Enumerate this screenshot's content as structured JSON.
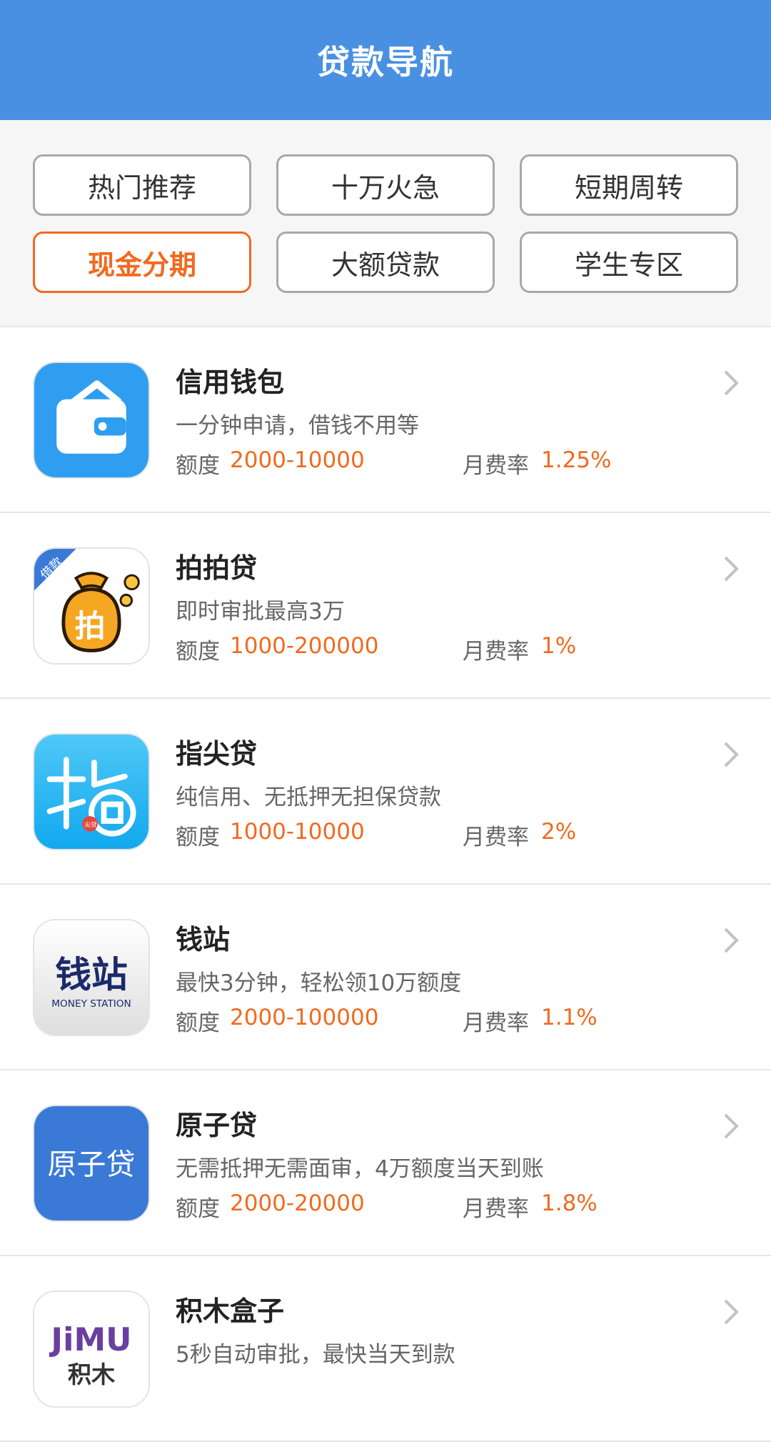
{
  "header": {
    "title": "贷款导航"
  },
  "filters": [
    {
      "label": "热门推荐",
      "active": false
    },
    {
      "label": "十万火急",
      "active": false
    },
    {
      "label": "短期周转",
      "active": false
    },
    {
      "label": "现金分期",
      "active": true
    },
    {
      "label": "大额贷款",
      "active": false
    },
    {
      "label": "学生专区",
      "active": false
    }
  ],
  "common": {
    "quota_label": "额度",
    "rate_label": "月费率"
  },
  "icons": {
    "ppd_badge": "借款",
    "ppd_char": "拍",
    "zjd_seal": "尖贷",
    "qz_name": "钱站",
    "qz_en": "MONEY STATION",
    "yzd_text": "原子贷",
    "jm_en": "JiMU",
    "jm_cn": "积木"
  },
  "loans": [
    {
      "name": "信用钱包",
      "desc": "一分钟申请，借钱不用等",
      "quota": "2000-10000",
      "rate": "1.25%",
      "icon": "wallet-app-icon",
      "color": "#2f9ef0"
    },
    {
      "name": "拍拍贷",
      "desc": "即时审批最高3万",
      "quota": "1000-200000",
      "rate": "1%",
      "icon": "money-bag-app-icon",
      "color": "#f5a623"
    },
    {
      "name": "指尖贷",
      "desc": "纯信用、无抵押无担保贷款",
      "quota": "1000-10000",
      "rate": "2%",
      "icon": "fingertip-app-icon",
      "color": "#1fb8f5"
    },
    {
      "name": "钱站",
      "desc": "最快3分钟，轻松领10万额度",
      "quota": "2000-100000",
      "rate": "1.1%",
      "icon": "money-station-app-icon",
      "color": "#1b2a6b"
    },
    {
      "name": "原子贷",
      "desc": "无需抵押无需面审，4万额度当天到账",
      "quota": "2000-20000",
      "rate": "1.8%",
      "icon": "atom-loan-app-icon",
      "color": "#3a7ad6"
    },
    {
      "name": "积木盒子",
      "desc": "5秒自动审批，最快当天到款",
      "quota": "",
      "rate": "",
      "icon": "jimu-box-app-icon",
      "color": "#6b3fa0"
    }
  ]
}
